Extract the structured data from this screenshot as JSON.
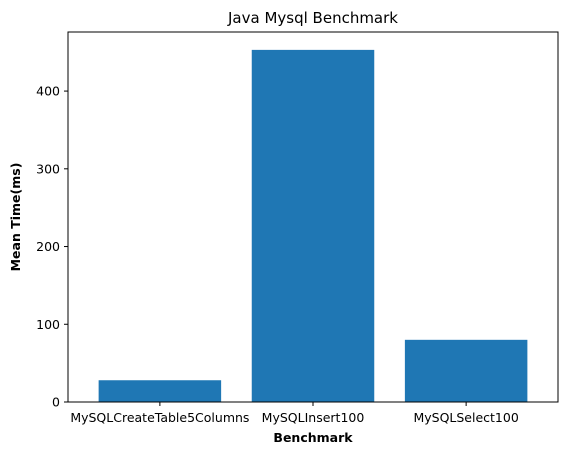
{
  "chart_data": {
    "type": "bar",
    "title": "Java Mysql Benchmark",
    "xlabel": "Benchmark",
    "ylabel": "Mean Time(ms)",
    "categories": [
      "MySQLCreateTable5Columns",
      "MySQLInsert100",
      "MySQLSelect100"
    ],
    "values": [
      28,
      453,
      80
    ],
    "ylim": [
      0,
      476
    ],
    "yticks": [
      0,
      100,
      200,
      300,
      400
    ],
    "grid": false,
    "bar_color": "#1f77b4"
  }
}
